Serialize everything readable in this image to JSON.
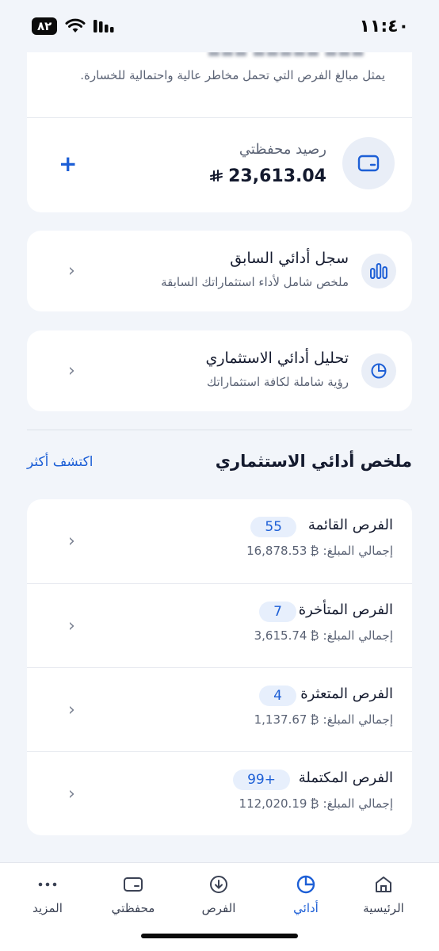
{
  "status_bar": {
    "time": "١١:٤٠",
    "battery": "٨٢"
  },
  "wallet_card": {
    "risk_note": "يمثل مبالغ الفرص التي تحمل مخاطر عالية واحتمالية للخسارة.",
    "label": "رصيد محفظتي",
    "amount": "23,613.04",
    "add_label": "+"
  },
  "nav_cards": [
    {
      "title": "سجل أدائي السابق",
      "subtitle": "ملخص شامل لأداء استثماراتك السابقة",
      "icon": "bar-chart-icon"
    },
    {
      "title": "تحليل أدائي الاستثماري",
      "subtitle": "رؤية شاملة لكافة استثماراتك",
      "icon": "pie-chart-icon"
    }
  ],
  "summary": {
    "title": "ملخص أدائي الاستثماري",
    "discover": "اكتشف أكثر",
    "total_label": "إجمالي المبلغ:",
    "rows": [
      {
        "title": "الفرص القائمة",
        "count": "55",
        "amount": "16,878.53"
      },
      {
        "title": "الفرص المتأخرة",
        "count": "7",
        "amount": "3,615.74"
      },
      {
        "title": "الفرص المتعثرة",
        "count": "4",
        "amount": "1,137.67"
      },
      {
        "title": "الفرص المكتملة",
        "count": "+99",
        "amount": "112,020.19"
      }
    ]
  },
  "bottom_nav": [
    {
      "label": "الرئيسية",
      "icon": "home-icon"
    },
    {
      "label": "أدائي",
      "icon": "pie-chart-icon",
      "active": true
    },
    {
      "label": "الفرص",
      "icon": "download-circle-icon"
    },
    {
      "label": "محفظتي",
      "icon": "wallet-icon"
    },
    {
      "label": "المزيد",
      "icon": "more-icon"
    }
  ],
  "colors": {
    "accent": "#1d5fd6",
    "background": "#f2f5fa",
    "text": "#141a2e",
    "muted": "#5b6375"
  }
}
